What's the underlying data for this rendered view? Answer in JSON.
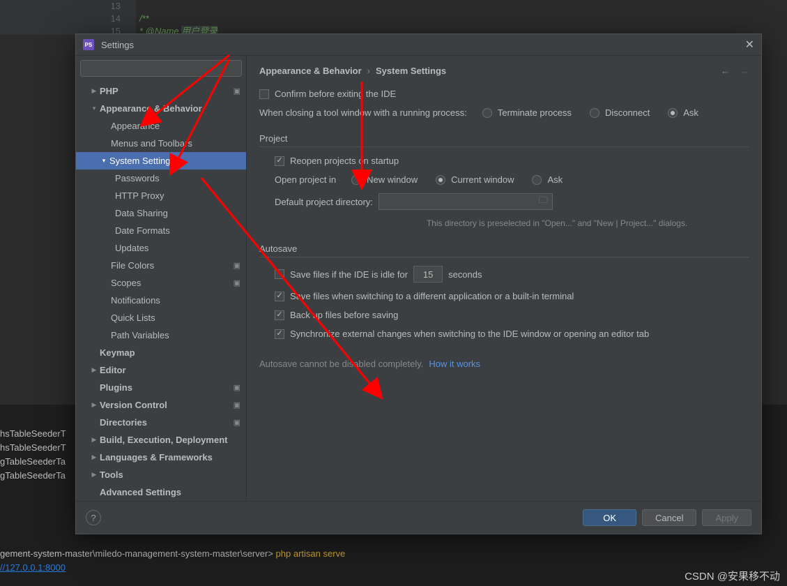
{
  "dialog_title": "Settings",
  "background": {
    "line_numbers": [
      "13",
      "14",
      "15"
    ],
    "doc_line1": "/**",
    "doc_line2": " * @Name ",
    "doc_cn": "用户登录"
  },
  "search_placeholder": "",
  "tree": {
    "php": "PHP",
    "ab": "Appearance & Behavior",
    "appearance": "Appearance",
    "menus": "Menus and Toolbars",
    "system_settings": "System Settings",
    "passwords": "Passwords",
    "http_proxy": "HTTP Proxy",
    "data_sharing": "Data Sharing",
    "date_formats": "Date Formats",
    "updates": "Updates",
    "file_colors": "File Colors",
    "scopes": "Scopes",
    "notifications": "Notifications",
    "quick_lists": "Quick Lists",
    "path_vars": "Path Variables",
    "keymap": "Keymap",
    "editor": "Editor",
    "plugins": "Plugins",
    "version_control": "Version Control",
    "directories": "Directories",
    "build": "Build, Execution, Deployment",
    "langs": "Languages & Frameworks",
    "tools": "Tools",
    "advanced": "Advanced Settings",
    "per_project": "▣"
  },
  "breadcrumb": {
    "root": "Appearance & Behavior",
    "leaf": "System Settings",
    "sep": "›"
  },
  "nav": {
    "back": "←",
    "forward": "→"
  },
  "confirm_exit": "Confirm before exiting the IDE",
  "closing_label": "When closing a tool window with a running process:",
  "closing_opts": {
    "terminate": "Terminate process",
    "disconnect": "Disconnect",
    "ask": "Ask"
  },
  "project": {
    "header": "Project",
    "reopen": "Reopen projects on startup",
    "open_in_label": "Open project in",
    "new_window": "New window",
    "current_window": "Current window",
    "ask": "Ask",
    "default_dir_label": "Default project directory:",
    "hint": "This directory is preselected in \"Open...\" and \"New | Project...\" dialogs."
  },
  "autosave": {
    "header": "Autosave",
    "idle_pre": "Save files if the IDE is idle for",
    "idle_value": "15",
    "idle_post": "seconds",
    "switch_app": "Save files when switching to a different application or a built-in terminal",
    "backup": "Back up files before saving",
    "sync": "Synchronize external changes when switching to the IDE window or opening an editor tab",
    "note": "Autosave cannot be disabled completely. ",
    "link": "How it works"
  },
  "buttons": {
    "ok": "OK",
    "cancel": "Cancel",
    "apply": "Apply",
    "help": "?"
  },
  "terminal": {
    "l1": "hsTableSeederT",
    "l2": "hsTableSeederT",
    "l3": "gTableSeederTa",
    "l4": "gTableSeederTa",
    "path": "gement-system-master\\miledo-management-system-master\\server>",
    "cmd": " php artisan serve",
    "url": "//127.0.0.1:8000"
  },
  "watermark": "CSDN @安果移不动"
}
